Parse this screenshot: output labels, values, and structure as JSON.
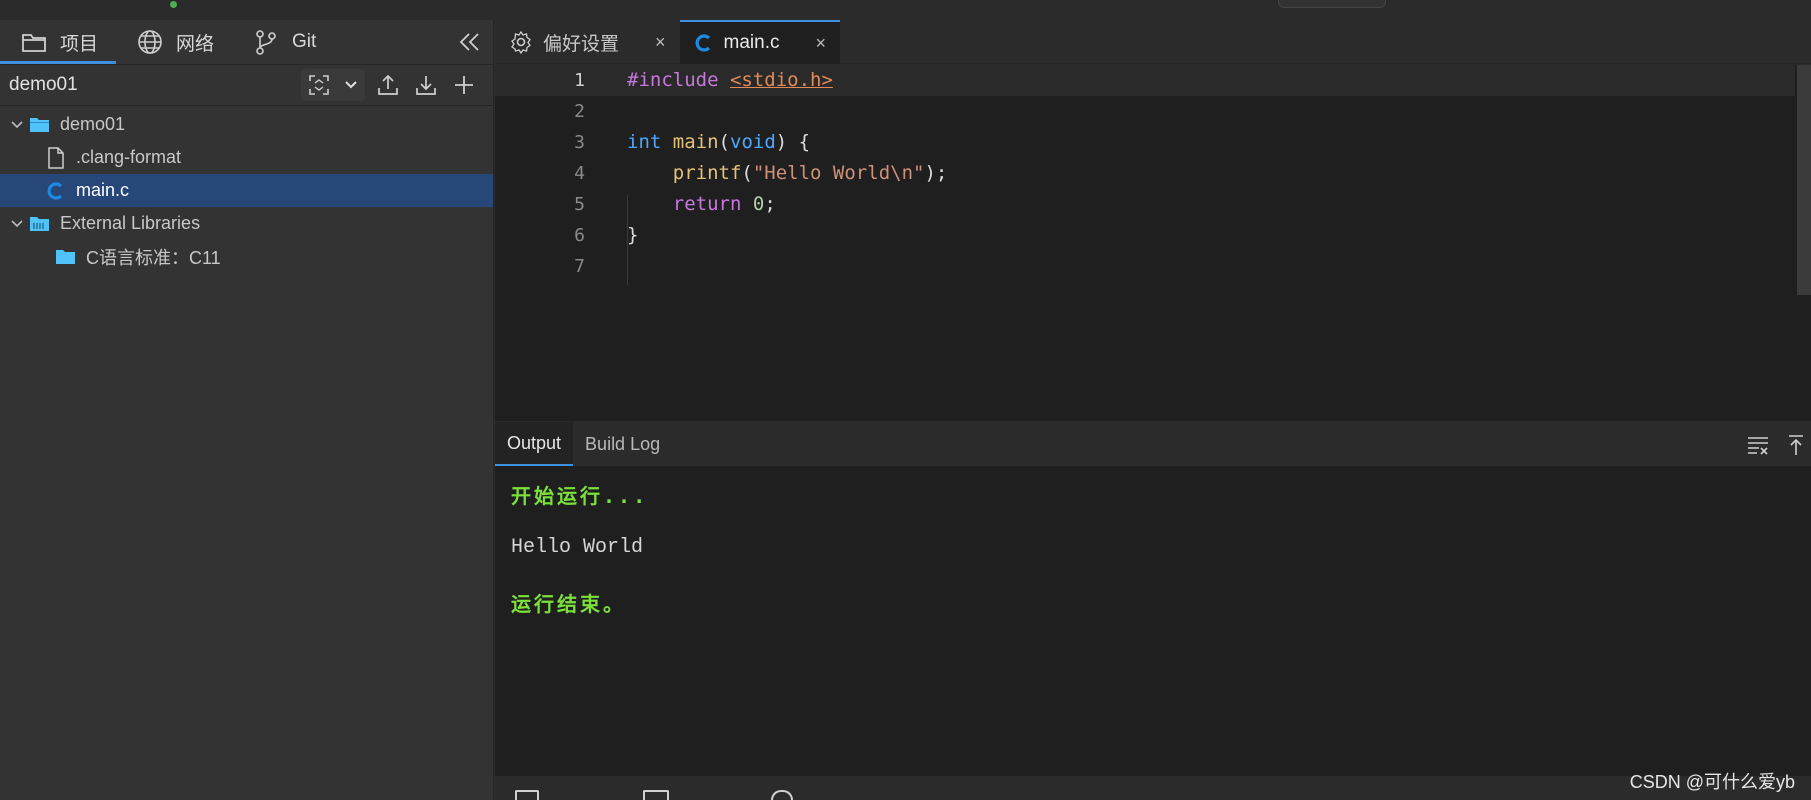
{
  "sidebar": {
    "tabs": [
      {
        "label": "项目",
        "icon": "folder-icon"
      },
      {
        "label": "网络",
        "icon": "globe-icon"
      },
      {
        "label": "Git",
        "icon": "git-branch-icon"
      }
    ],
    "project_name": "demo01",
    "tree": [
      {
        "label": "demo01",
        "type": "folder"
      },
      {
        "label": ".clang-format",
        "type": "file"
      },
      {
        "label": "main.c",
        "type": "c-file"
      },
      {
        "label": "External Libraries",
        "type": "library-folder"
      },
      {
        "label": "C语言标准：C11",
        "type": "folder"
      }
    ]
  },
  "editor": {
    "tabs": [
      {
        "label": "偏好设置",
        "icon": "gear-icon",
        "close": "×"
      },
      {
        "label": "main.c",
        "icon": "c-file-icon",
        "close": "×"
      }
    ],
    "line_numbers": [
      "1",
      "2",
      "3",
      "4",
      "5",
      "6",
      "7"
    ],
    "code": {
      "l1_kw": "#include ",
      "l1_inc": "<stdio.h>",
      "l3_type": "int",
      "l3_fn": "main",
      "l3_open": "(",
      "l3_void": "void",
      "l3_close": ") {",
      "l4_fn": "printf",
      "l4_open": "(",
      "l4_str": "\"Hello World\\n\"",
      "l4_close": ");",
      "l5_kw": "return",
      "l5_num": "0",
      "l5_end": ";",
      "l6": "}"
    }
  },
  "output_panel": {
    "tabs": [
      "Output",
      "Build Log"
    ],
    "lines": [
      "开始运行...",
      "Hello World",
      "运行结束。"
    ]
  },
  "watermark": "CSDN @可什么爱yb",
  "colors": {
    "accent": "#3d8fe0",
    "selection": "#264777",
    "run_text": "#7ce03a",
    "folder": "#4fc3f7"
  }
}
